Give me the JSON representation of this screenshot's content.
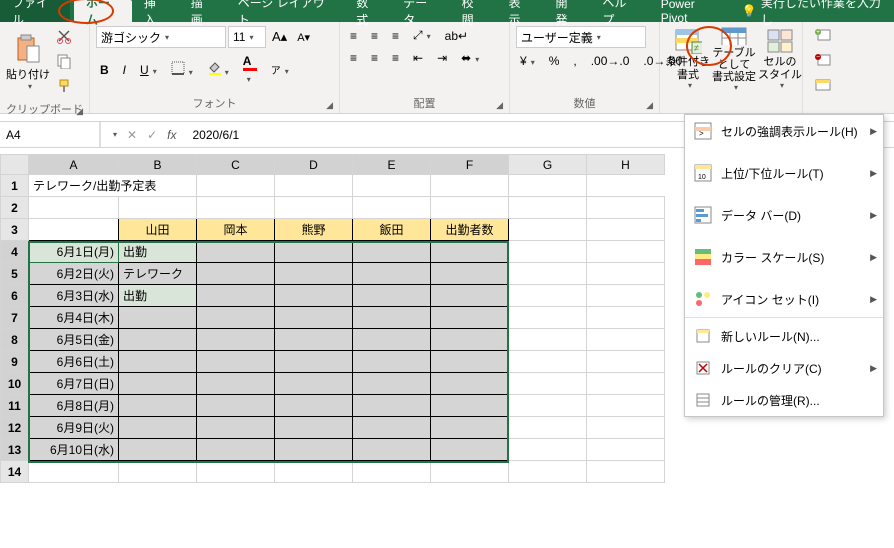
{
  "tabs": {
    "file": "ファイル",
    "home": "ホーム",
    "insert": "挿入",
    "draw": "描画",
    "page_layout": "ページ レイアウト",
    "formulas": "数式",
    "data": "データ",
    "review": "校閲",
    "view": "表示",
    "developer": "開発",
    "help": "ヘルプ",
    "power_pivot": "Power Pivot",
    "tell_me": "実行したい作業を入力し"
  },
  "ribbon": {
    "clipboard": {
      "label": "クリップボード",
      "paste": "貼り付け"
    },
    "font": {
      "label": "フォント",
      "name": "游ゴシック",
      "size": "11",
      "bold": "B",
      "italic": "I",
      "underline": "U"
    },
    "alignment": {
      "label": "配置"
    },
    "number": {
      "label": "数値",
      "format": "ユーザー定義"
    },
    "cf": {
      "label": "条件付き\n書式"
    },
    "table": {
      "label": "テーブルとして\n書式設定"
    },
    "cell_styles": {
      "label": "セルの\nスタイル"
    }
  },
  "formula_bar": {
    "name_box": "A4",
    "formula": "2020/6/1"
  },
  "columns": [
    "A",
    "B",
    "C",
    "D",
    "E",
    "F",
    "G",
    "H"
  ],
  "rows": [
    "1",
    "2",
    "3",
    "4",
    "5",
    "6",
    "7",
    "8",
    "9",
    "10",
    "11",
    "12",
    "13",
    "14"
  ],
  "sheet": {
    "title": "テレワーク/出勤予定表",
    "headers": [
      "山田",
      "岡本",
      "熊野",
      "飯田",
      "出勤者数"
    ],
    "dates": [
      "6月1日(月)",
      "6月2日(火)",
      "6月3日(水)",
      "6月4日(木)",
      "6月5日(金)",
      "6月6日(土)",
      "6月7日(日)",
      "6月8日(月)",
      "6月9日(火)",
      "6月10日(水)"
    ],
    "b_cells": [
      "出勤",
      "テレワーク",
      "出勤",
      "",
      "",
      "",
      "",
      "",
      "",
      ""
    ]
  },
  "menu": {
    "highlight_rules": "セルの強調表示ルール(H)",
    "top_bottom": "上位/下位ルール(T)",
    "data_bars": "データ バー(D)",
    "color_scales": "カラー スケール(S)",
    "icon_sets": "アイコン セット(I)",
    "new_rule": "新しいルール(N)...",
    "clear_rules": "ルールのクリア(C)",
    "manage_rules": "ルールの管理(R)..."
  }
}
